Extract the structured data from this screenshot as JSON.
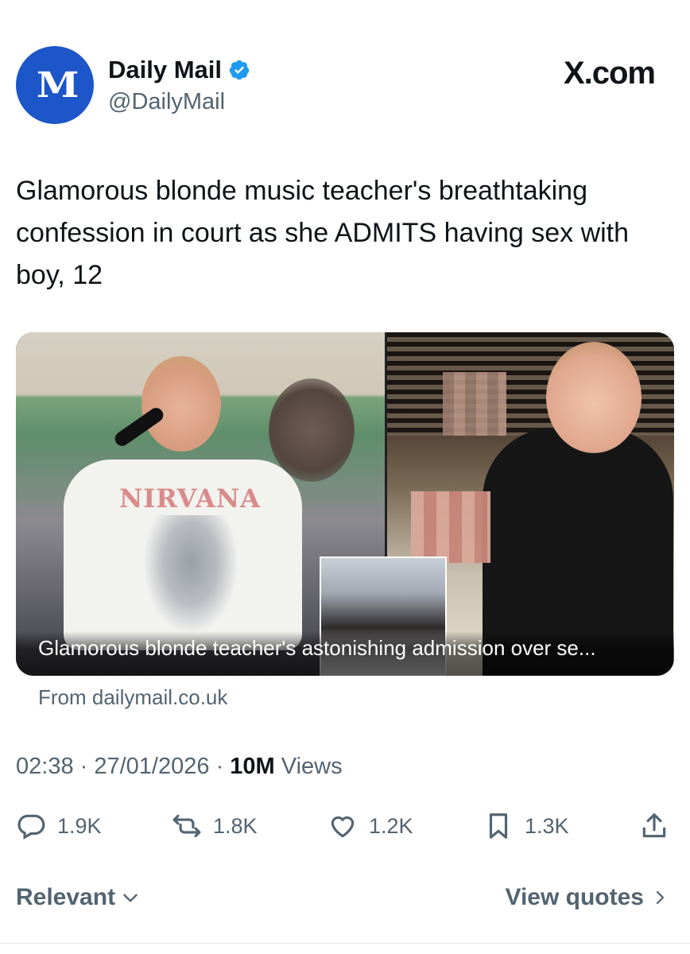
{
  "header": {
    "avatar_glyph": "M",
    "name": "Daily Mail",
    "handle": "@DailyMail",
    "platform_logo": "X.com"
  },
  "tweet": {
    "text": "Glamorous blonde music teacher's breathtaking confession in court as she ADMITS having sex with boy, 12"
  },
  "card": {
    "shirt_text": "NIRVANA",
    "caption": "Glamorous blonde teacher's astonishing admission over se...",
    "source": "From dailymail.co.uk"
  },
  "meta": {
    "time": "02:38",
    "date": "27/01/2026",
    "views_count": "10M",
    "views_label": "Views"
  },
  "actions": {
    "replies": "1.9K",
    "reposts": "1.8K",
    "likes": "1.2K",
    "bookmarks": "1.3K"
  },
  "footer": {
    "sort_label": "Relevant",
    "quotes_label": "View quotes"
  },
  "colors": {
    "brand_blue": "#1d56c8",
    "verified_blue": "#1d9bf0",
    "secondary_text": "#536471"
  },
  "icons": [
    "verified-badge-icon",
    "reply-icon",
    "repost-icon",
    "like-icon",
    "bookmark-icon",
    "share-icon",
    "chevron-down-icon",
    "chevron-right-icon"
  ]
}
